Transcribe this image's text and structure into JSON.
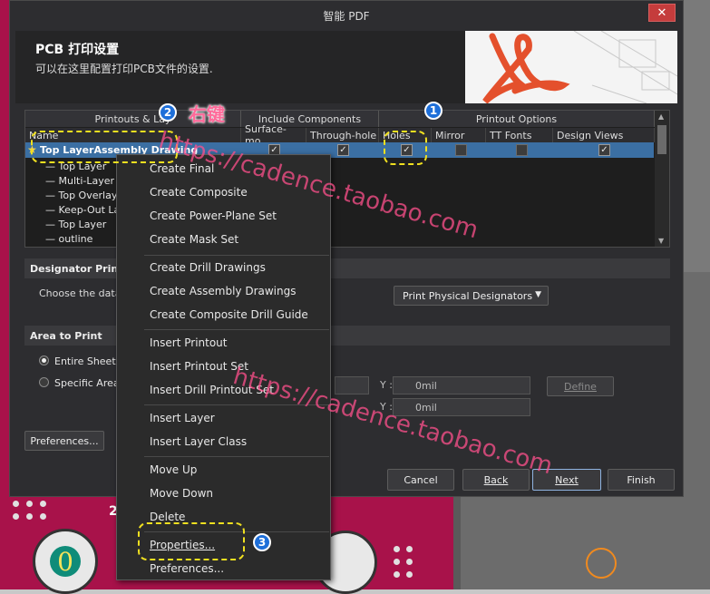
{
  "window": {
    "title": "智能 PDF",
    "close": "✕"
  },
  "header": {
    "title": "PCB 打印设置",
    "subtitle": "可以在这里配置打印PCB文件的设置."
  },
  "grid": {
    "group_headers": [
      "Printouts & Lay",
      "Include Components",
      "Printout Options"
    ],
    "columns": [
      "Name",
      "Surface-mo...",
      "Through-hole",
      "Holes",
      "Mirror",
      "TT Fonts",
      "Design Views"
    ],
    "selected_row": "Top LayerAssembly Drawing",
    "layers": [
      "Top Layer",
      "Multi-Layer",
      "Top Overlay",
      "Keep-Out Lay",
      "Top Layer",
      "outline"
    ]
  },
  "designator": {
    "section": "Designator Print Se",
    "label": "Choose the data",
    "dropdown": "Print Physical Designators"
  },
  "area": {
    "section": "Area to Print",
    "entire": "Entire Sheet",
    "specific": "Specific Area",
    "y_label": "Y :",
    "y1": "0mil",
    "y2": "0mil",
    "define": "Define"
  },
  "buttons": {
    "preferences": "Preferences...",
    "cancel": "Cancel",
    "back": "Back",
    "next": "Next",
    "finish": "Finish"
  },
  "menu": {
    "items": [
      "Create Final",
      "Create Composite",
      "Create Power-Plane Set",
      "Create Mask Set",
      "Create Drill Drawings",
      "Create Assembly Drawings",
      "Create Composite Drill Guide",
      "Insert Printout",
      "Insert Printout Set",
      "Insert Drill Printout Set",
      "Insert Layer",
      "Insert Layer Class",
      "Move Up",
      "Move Down",
      "Delete",
      "Properties...",
      "Preferences..."
    ]
  },
  "annotations": {
    "badge1": "1",
    "badge2": "2",
    "badge3": "3",
    "right_click": "右键",
    "watermark": "https://cadence.taobao.com"
  },
  "pcb": {
    "pad_label": "0",
    "digit": "2"
  }
}
